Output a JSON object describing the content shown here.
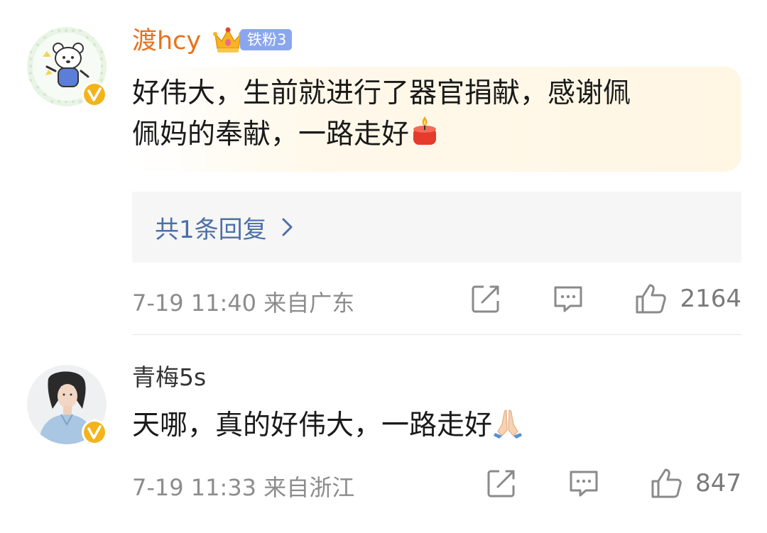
{
  "comments": [
    {
      "username": "渡hcy",
      "fan_badge": "铁粉3",
      "content": "好伟大，生前就进行了器官捐献，感谢佩",
      "content_line2": "佩妈的奉献，一路走好",
      "emoji": "candle-emoji",
      "reply_summary": "共1条回复",
      "time": "7-19 11:40",
      "location": "来自广东",
      "likes": "2164"
    },
    {
      "username": "青梅5s",
      "content": "天哪，真的好伟大，一路走好",
      "emoji": "praying-hands-emoji",
      "time": "7-19 11:33",
      "location": "来自浙江",
      "likes": "847"
    }
  ],
  "colors": {
    "username_vip": "#e8721c",
    "reply_link": "#4d6fa8",
    "meta_gray": "#8c8c8c",
    "verified_badge": "#f3b41b",
    "fan_badge_bg": "#8aa6ee"
  }
}
